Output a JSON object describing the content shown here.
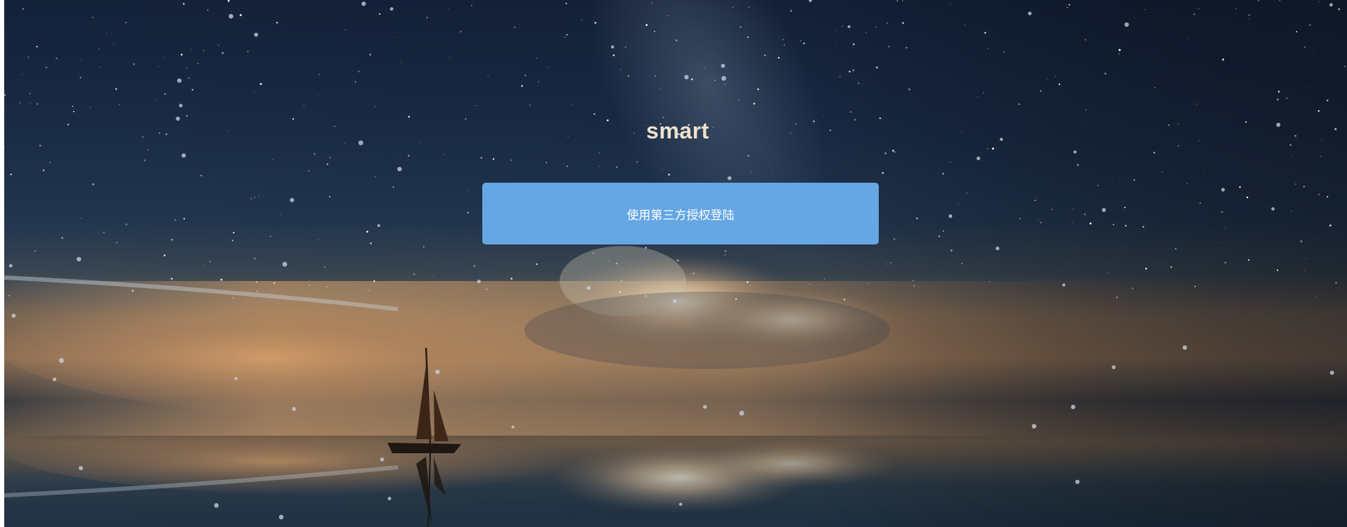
{
  "app": {
    "title": "smart"
  },
  "login": {
    "auth_button_label": "使用第三方授权登陆"
  },
  "theme": {
    "button_color": "#65a6e3",
    "title_color": "#eee2cd"
  }
}
